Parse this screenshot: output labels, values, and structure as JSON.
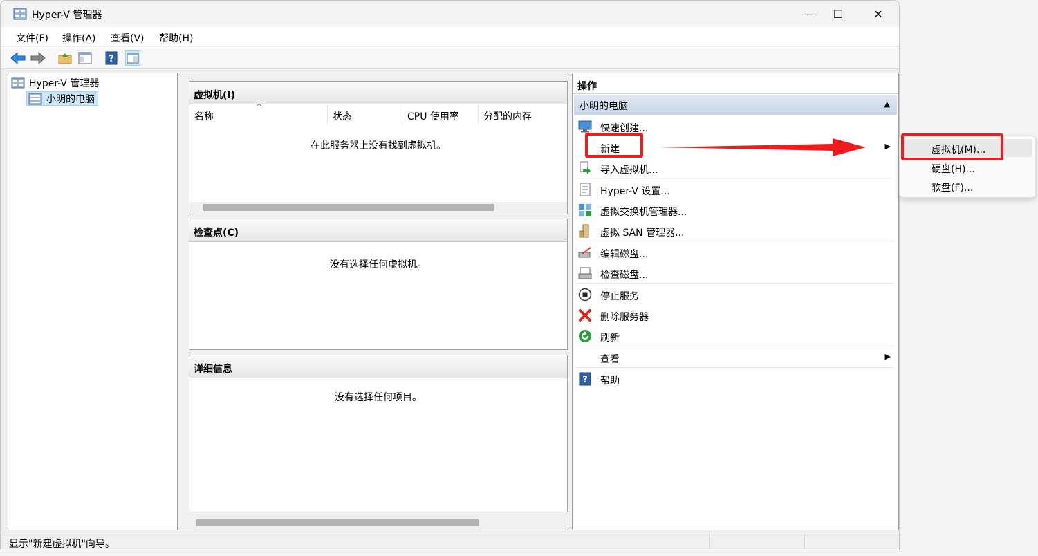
{
  "window": {
    "title": "Hyper-V 管理器"
  },
  "controls": {
    "minimize": "—",
    "maximize": "☐",
    "close": "✕"
  },
  "menu": [
    "文件(F)",
    "操作(A)",
    "查看(V)",
    "帮助(H)"
  ],
  "tree": {
    "root": "Hyper-V 管理器",
    "child": "小明的电脑"
  },
  "vm_section": {
    "title": "虚拟机(I)",
    "columns": [
      "名称",
      "状态",
      "CPU 使用率",
      "分配的内存"
    ],
    "sort_indicator": "^",
    "empty": "在此服务器上没有找到虚拟机。"
  },
  "checkpoint_section": {
    "title": "检查点(C)",
    "empty": "没有选择任何虚拟机。"
  },
  "details_section": {
    "title": "详细信息",
    "empty": "没有选择任何项目。"
  },
  "actions": {
    "title": "操作",
    "group": "小明的电脑",
    "collapse_glyph": "▲",
    "items": [
      {
        "label": "快速创建...",
        "icon": "quick-create-icon"
      },
      {
        "label": "新建",
        "icon": "",
        "submenu": true
      },
      {
        "label": "导入虚拟机...",
        "icon": "import-icon"
      },
      {
        "label": "Hyper-V 设置...",
        "icon": "settings-icon"
      },
      {
        "label": "虚拟交换机管理器...",
        "icon": "switch-icon"
      },
      {
        "label": "虚拟 SAN 管理器...",
        "icon": "san-icon"
      },
      {
        "label": "编辑磁盘...",
        "icon": "edit-disk-icon"
      },
      {
        "label": "检查磁盘...",
        "icon": "inspect-disk-icon"
      },
      {
        "label": "停止服务",
        "icon": "stop-icon"
      },
      {
        "label": "删除服务器",
        "icon": "delete-icon"
      },
      {
        "label": "刷新",
        "icon": "refresh-icon"
      },
      {
        "label": "查看",
        "icon": "",
        "submenu": true
      },
      {
        "label": "帮助",
        "icon": "help-icon"
      }
    ],
    "submenu_arrow": "▶"
  },
  "submenu": [
    "虚拟机(M)...",
    "硬盘(H)...",
    "软盘(F)..."
  ],
  "status": "显示\"新建虚拟机\"向导。",
  "colors": {
    "highlight": "#ee1c1c",
    "selection": "#cce8ff",
    "group_header": "#c8d6e8"
  }
}
